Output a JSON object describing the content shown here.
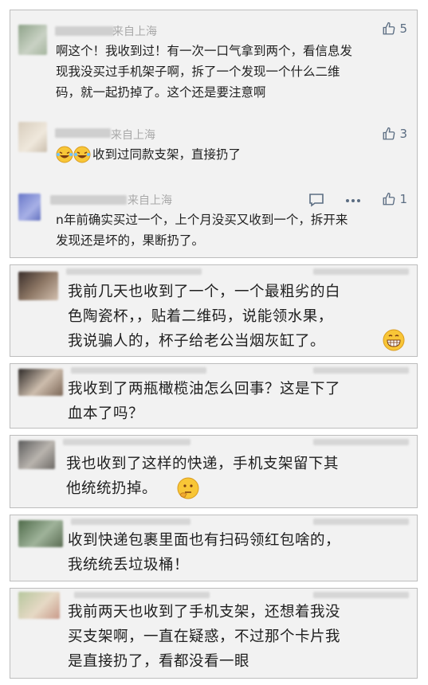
{
  "thread": [
    {
      "location": "来自上海",
      "likes": "5",
      "text": "啊这个！我收到过！有一次一口气拿到两个，看信息发\n现我没买过手机架子啊，拆了一个发现一个什么二维\n码，就一起扔掉了。这个还是要注意啊"
    },
    {
      "location": "来自上海",
      "likes": "3",
      "text": "收到过同款支架，直接扔了"
    },
    {
      "location": "来自上海",
      "likes": "1",
      "text": "n年前确实买过一个，上个月没买又收到一个，拆开来\n发现还是坏的，果断扔了。"
    }
  ],
  "comments": [
    {
      "text": "我前几天也收到了一个，一个最粗劣的白\n色陶瓷杯，，贴着二维码，说能领水果，\n我说骗人的，杯子给老公当烟灰缸了。"
    },
    {
      "text": "我收到了两瓶橄榄油怎么回事？这是下了\n血本了吗？"
    },
    {
      "text": "我也收到了这样的快递，手机支架留下其\n他统统扔掉。"
    },
    {
      "text": "收到快递包裹里面也有扫码领红包啥的，\n我统统丢垃圾桶！"
    },
    {
      "text": "我前两天也收到了手机支架，还想着我没\n买支架啊，一直在疑惑，不过那个卡片我\n是直接扔了，看都没看一眼"
    }
  ],
  "colors": {
    "card_bg": "#f2f2f2",
    "border": "#bdbdbd",
    "like_icon": "#5b6d82",
    "meta": "#a8a8a8"
  }
}
